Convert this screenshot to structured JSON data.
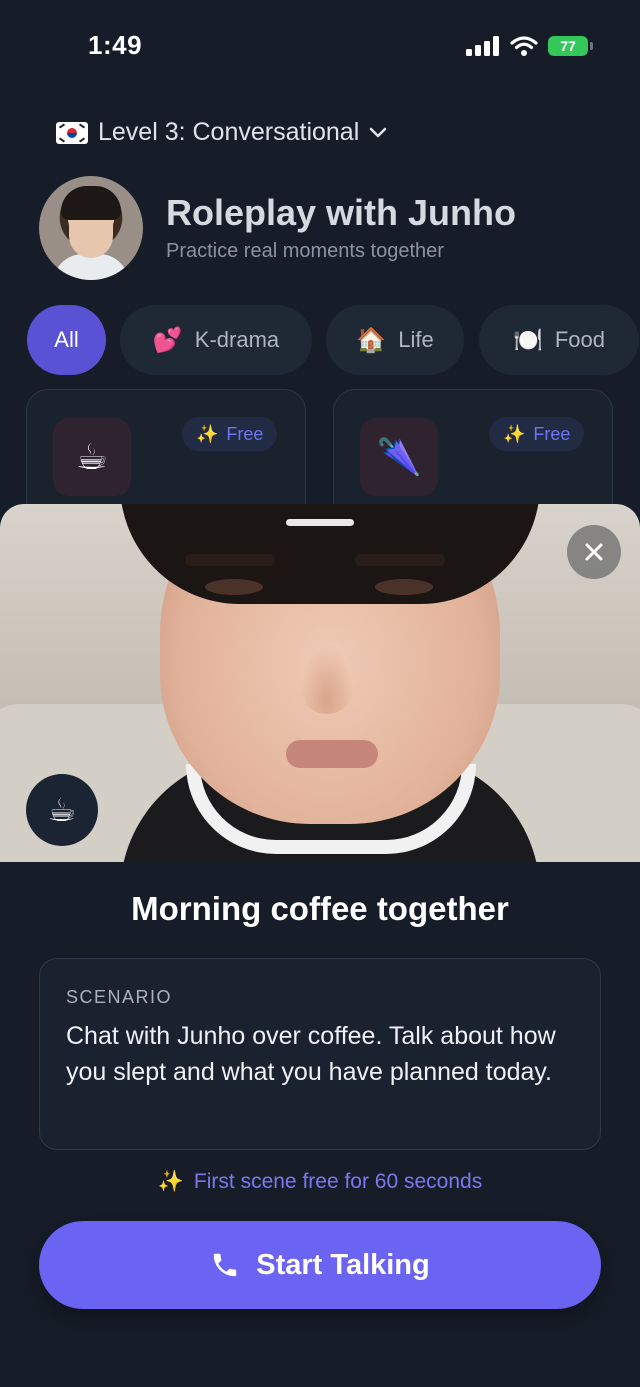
{
  "status_bar": {
    "time": "1:49",
    "battery": "77"
  },
  "level": {
    "label": "Level 3: Conversational"
  },
  "header": {
    "title": "Roleplay with Junho",
    "subtitle": "Practice real moments together"
  },
  "categories": [
    {
      "label": "All",
      "emoji": "",
      "active": true
    },
    {
      "label": "K-drama",
      "emoji": "💕"
    },
    {
      "label": "Life",
      "emoji": "🏠"
    },
    {
      "label": "Food",
      "emoji": "🍽️"
    }
  ],
  "cards": [
    {
      "icon": "☕",
      "badge": "Free",
      "badge_emoji": "✨"
    },
    {
      "icon": "🌂",
      "badge": "Free",
      "badge_emoji": "✨"
    }
  ],
  "scene": {
    "title": "Morning coffee together",
    "badge_icon": "☕",
    "scenario_label": "SCENARIO",
    "scenario_text": "Chat with Junho over coffee. Talk about how you slept and what you have planned today.",
    "promo_emoji": "✨",
    "promo": "First scene free for 60 seconds",
    "cta_label": "Start Talking"
  },
  "colors": {
    "accent": "#6b63f2",
    "background": "#161d28",
    "promo": "#7b78ee"
  }
}
